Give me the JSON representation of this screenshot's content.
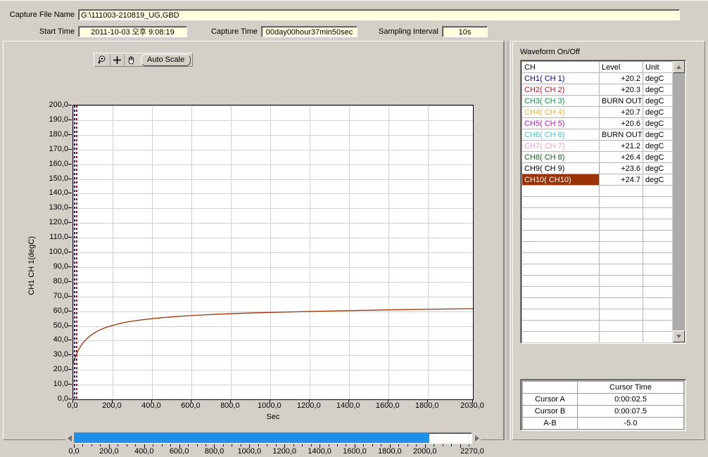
{
  "header": {
    "capture_file_label": "Capture File Name",
    "capture_file_value": "G:\\111003-210819_UG,GBD",
    "start_time_label": "Start Time",
    "start_time_value": "2011-10-03 오후 9:08:19",
    "capture_time_label": "Capture Time",
    "capture_time_value": "00day00hour37min50sec",
    "sampling_label": "Sampling Interval",
    "sampling_value": "10s"
  },
  "toolbar": {
    "zoom_icon": "magnifier-zoom-icon",
    "crosshair_icon": "crosshair-icon",
    "pan_icon": "hand-pan-icon",
    "autoscale_label": "Auto Scale"
  },
  "chart_data": {
    "type": "line",
    "title": "",
    "xlabel": "Sec",
    "ylabel": "CH1  CH 1(degC)",
    "xlim": [
      0,
      2030
    ],
    "ylim": [
      0,
      200
    ],
    "xticks": [
      "0,0",
      "200,0",
      "400,0",
      "600,0",
      "800,0",
      "1000,0",
      "1200,0",
      "1400,0",
      "1600,0",
      "1800,0",
      "2030,0"
    ],
    "xtick_values": [
      0,
      200,
      400,
      600,
      800,
      1000,
      1200,
      1400,
      1600,
      1800,
      2030
    ],
    "yticks": [
      "0,0",
      "10,0",
      "20,0",
      "30,0",
      "40,0",
      "50,0",
      "60,0",
      "70,0",
      "80,0",
      "90,0",
      "100,0",
      "110,0",
      "120,0",
      "130,0",
      "140,0",
      "150,0",
      "160,0",
      "170,0",
      "180,0",
      "190,0",
      "200,0"
    ],
    "ytick_values": [
      0,
      10,
      20,
      30,
      40,
      50,
      60,
      70,
      80,
      90,
      100,
      110,
      120,
      130,
      140,
      150,
      160,
      170,
      180,
      190,
      200
    ],
    "grid": true,
    "legend": "none",
    "series": [
      {
        "name": "CH10( CH10)",
        "color": "#9c3206",
        "x": [
          0,
          10,
          20,
          30,
          40,
          50,
          60,
          80,
          100,
          120,
          140,
          160,
          180,
          200,
          240,
          280,
          320,
          360,
          400,
          450,
          500,
          560,
          620,
          680,
          740,
          800,
          880,
          960,
          1040,
          1120,
          1200,
          1300,
          1400,
          1500,
          1600,
          1700,
          1800,
          1900,
          2030
        ],
        "y": [
          24.7,
          28.5,
          31.8,
          34.4,
          36.6,
          38.4,
          40.0,
          42.6,
          44.6,
          46.2,
          47.5,
          48.6,
          49.5,
          50.3,
          51.7,
          52.8,
          53.6,
          54.3,
          54.9,
          55.6,
          56.1,
          56.7,
          57.2,
          57.6,
          58.0,
          58.3,
          58.7,
          59.0,
          59.3,
          59.5,
          59.8,
          60.1,
          60.4,
          60.6,
          60.9,
          61.1,
          61.3,
          61.5,
          61.7
        ]
      }
    ],
    "cursors": [
      {
        "name": "Cursor A",
        "x": 2.5,
        "color": "#1a1a8c"
      },
      {
        "name": "Cursor B",
        "x": 7.5,
        "color": "#a01010"
      }
    ]
  },
  "hscroll": {
    "min": 0,
    "max": 2270,
    "thumb_end": 2030,
    "labels": [
      "0,0",
      "200,0",
      "400,0",
      "600,0",
      "800,0",
      "1000,0",
      "1200,0",
      "1400,0",
      "1600,0",
      "1800,0",
      "2000,0",
      "2270,0"
    ],
    "label_values": [
      0,
      200,
      400,
      600,
      800,
      1000,
      1200,
      1400,
      1600,
      1800,
      2000,
      2270
    ],
    "left_arrow_icon": "triangle-left-icon",
    "right_arrow_icon": "triangle-right-icon",
    "fill_color": "#1e90e8"
  },
  "waveform": {
    "title": "Waveform On/Off",
    "columns": [
      "CH",
      "Level",
      "Unit"
    ],
    "scroll_up_icon": "triangle-up-icon",
    "scroll_down_icon": "triangle-down-icon",
    "rows": [
      {
        "ch": "CH1( CH 1)",
        "level": "+20.2",
        "unit": "degC",
        "color": "#0000a0",
        "bg": "#ffffff",
        "state": "normal"
      },
      {
        "ch": "CH2( CH 2)",
        "level": "+20.3",
        "unit": "degC",
        "color": "#c01828",
        "bg": "#ffffff",
        "state": "normal"
      },
      {
        "ch": "CH3( CH 3)",
        "level": "BURN OUT",
        "unit": "degC",
        "color": "#00a040",
        "bg": "#ffffff",
        "state": "normal"
      },
      {
        "ch": "CH4( CH 4)",
        "level": "+20.7",
        "unit": "degC",
        "color": "#f0b030",
        "bg": "#ffffff",
        "state": "normal"
      },
      {
        "ch": "CH5( CH 5)",
        "level": "+20.6",
        "unit": "degC",
        "color": "#b818c0",
        "bg": "#ffffff",
        "state": "normal"
      },
      {
        "ch": "CH6( CH 6)",
        "level": "BURN OUT",
        "unit": "degC",
        "color": "#40c8e0",
        "bg": "#ffffff",
        "state": "normal"
      },
      {
        "ch": "CH7( CH 7)",
        "level": "+21.2",
        "unit": "degC",
        "color": "#f0a0c8",
        "bg": "#ffffff",
        "state": "normal"
      },
      {
        "ch": "CH8( CH 8)",
        "level": "+26.4",
        "unit": "degC",
        "color": "#106818",
        "bg": "#ffffff",
        "state": "normal"
      },
      {
        "ch": "CH9( CH 9)",
        "level": "+23.6",
        "unit": "degC",
        "color": "#000000",
        "bg": "#ffffff",
        "state": "selected"
      },
      {
        "ch": "CH10( CH10)",
        "level": "+24.7",
        "unit": "degC",
        "color": "#ffffff",
        "bg": "#9c3206",
        "state": "highlighted"
      }
    ],
    "empty_row_count": 14
  },
  "cursor_table": {
    "header_blank": "",
    "header_time": "Cursor Time",
    "rows": [
      {
        "label": "Cursor A",
        "value": "0:00:02.5"
      },
      {
        "label": "Cursor B",
        "value": "0:00:07.5"
      },
      {
        "label": "A-B",
        "value": "-5.0"
      }
    ]
  }
}
